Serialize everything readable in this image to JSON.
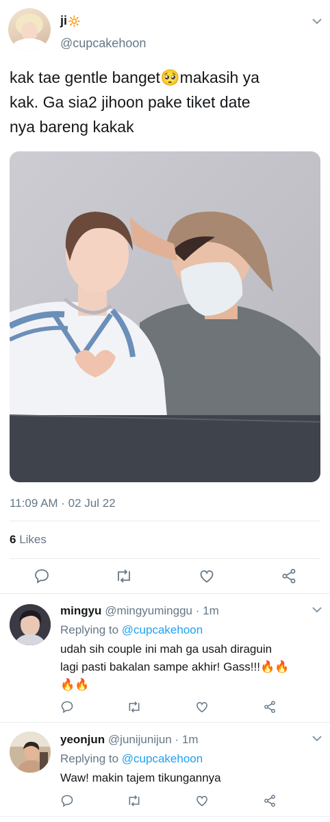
{
  "tweet": {
    "display_name": "ji",
    "name_emoji": "🔆",
    "handle": "@cupcakehoon",
    "text_line1": "kak tae gentle banget🥺makasih ya",
    "text_line2": "kak. Ga sia2 jihoon pake tiket date",
    "text_line3": "nya bareng kakak",
    "timestamp": "11:09 AM · 02 Jul 22",
    "likes_count": "6",
    "likes_label": "Likes"
  },
  "replies": [
    {
      "name": "mingyu",
      "handle": "@mingyuminggu",
      "time": "· 1m",
      "replying_label": "Replying to",
      "replying_handle": "@cupcakehoon",
      "text_line1": "udah sih couple ini mah ga usah diraguin",
      "text_line2": "lagi pasti bakalan sampe akhir! Gass!!!🔥🔥",
      "text_line3": "🔥🔥"
    },
    {
      "name": "yeonjun",
      "handle": "@junijunijun",
      "time": "· 1m",
      "replying_label": "Replying to",
      "replying_handle": "@cupcakehoon",
      "text_line1": "Waw! makin tajem tikungannya"
    }
  ],
  "icons": [
    "chevron-down-icon",
    "reply-icon",
    "retweet-icon",
    "like-icon",
    "share-icon"
  ],
  "colors": {
    "link": "#1da1f2",
    "muted": "#657786",
    "divider": "#e6ecf0",
    "text": "#14171a"
  }
}
